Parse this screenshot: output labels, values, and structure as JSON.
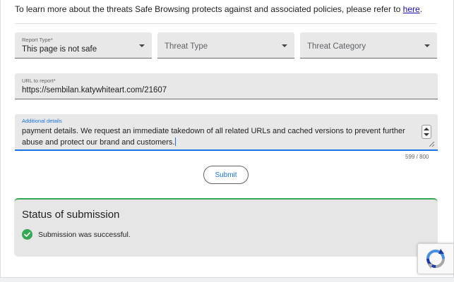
{
  "intro": {
    "text": "To learn more about the threats Safe Browsing protects against and associated policies, please refer to ",
    "link_text": "here",
    "trailing": "."
  },
  "form": {
    "report_type": {
      "label": "Report Type*",
      "value": "This page is not safe"
    },
    "threat_type": {
      "placeholder": "Threat Type"
    },
    "threat_category": {
      "placeholder": "Threat Category"
    },
    "url": {
      "label": "URL to report*",
      "value": "https://sembilan.katywhiteart.com/21607"
    },
    "details": {
      "label": "Additional details",
      "value": "payment details. We request an immediate takedown of all related URLs and cached versions to prevent further abuse and protect our brand and customers.",
      "counter": "599 / 800"
    },
    "submit_label": "Submit"
  },
  "status": {
    "title": "Status of submission",
    "message": "Submission was successful."
  },
  "colors": {
    "accent": "#1a73e8",
    "success": "#34a853",
    "field_bg": "#e8e8e8"
  },
  "icons": {
    "dropdown": "chevron-down-icon",
    "success": "check-circle-icon",
    "recaptcha": "recaptcha-icon"
  }
}
